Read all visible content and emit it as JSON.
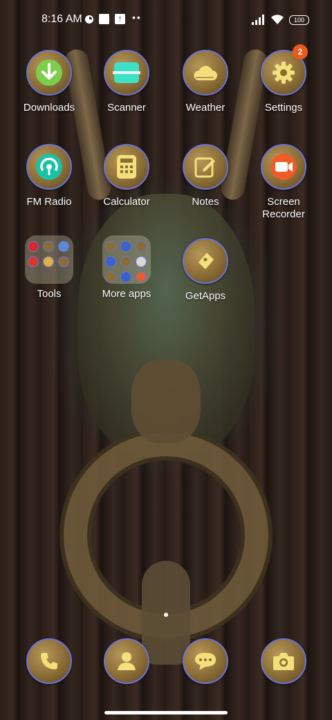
{
  "status_bar": {
    "time": "8:16 AM",
    "battery": "100"
  },
  "apps": [
    {
      "label": "Downloads",
      "icon": "download-icon"
    },
    {
      "label": "Scanner",
      "icon": "scanner-icon"
    },
    {
      "label": "Weather",
      "icon": "weather-icon"
    },
    {
      "label": "Settings",
      "icon": "gear-icon",
      "badge": "2"
    },
    {
      "label": "FM Radio",
      "icon": "radio-icon"
    },
    {
      "label": "Calculator",
      "icon": "calculator-icon"
    },
    {
      "label": "Notes",
      "icon": "notes-icon"
    },
    {
      "label": "Screen Recorder",
      "icon": "screen-recorder-icon"
    },
    {
      "label": "Tools",
      "icon": "folder-icon"
    },
    {
      "label": "More apps",
      "icon": "folder-icon"
    },
    {
      "label": "GetApps",
      "icon": "getapps-icon"
    }
  ],
  "dock": [
    {
      "icon": "phone-icon"
    },
    {
      "icon": "contacts-icon"
    },
    {
      "icon": "messages-icon"
    },
    {
      "icon": "camera-icon"
    }
  ],
  "colors": {
    "icon_ring": "#6a74d8",
    "icon_glyph": "#f4e07a",
    "badge": "#ea5a18"
  }
}
